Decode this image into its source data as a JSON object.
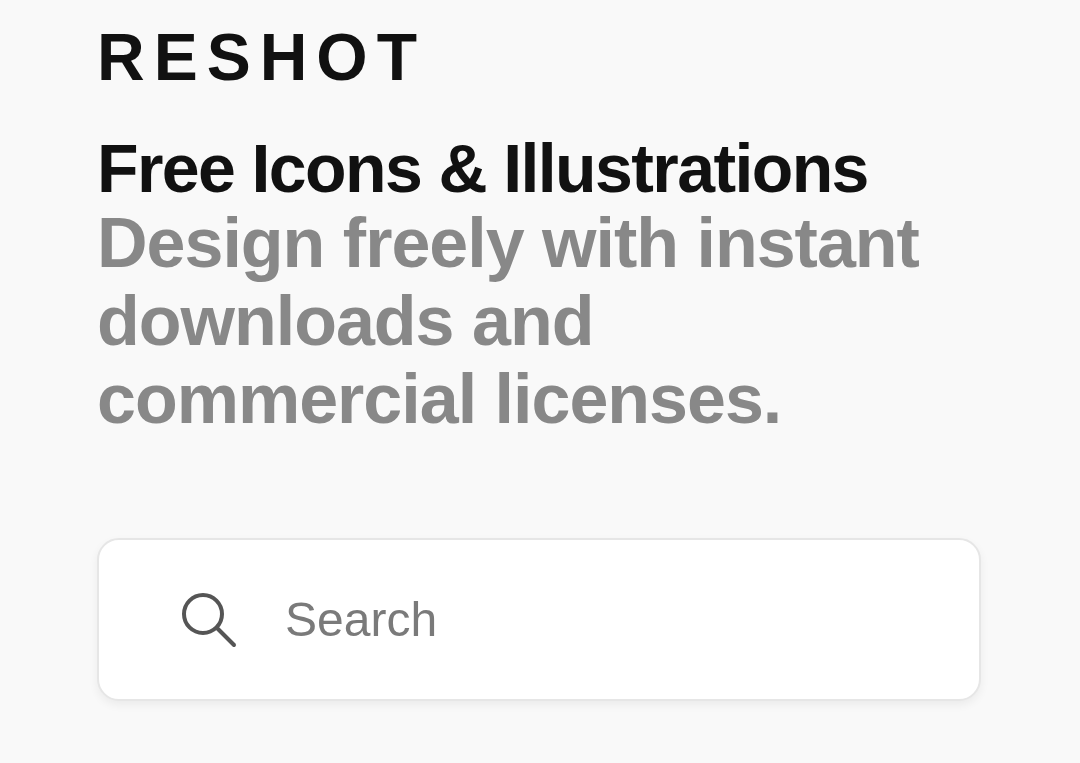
{
  "logo": "RESHOT",
  "title": "Free Icons & Illustrations",
  "subtitle_lines": [
    "Design freely with instant",
    "downloads and",
    "commercial licenses."
  ],
  "search": {
    "placeholder": "Search"
  }
}
